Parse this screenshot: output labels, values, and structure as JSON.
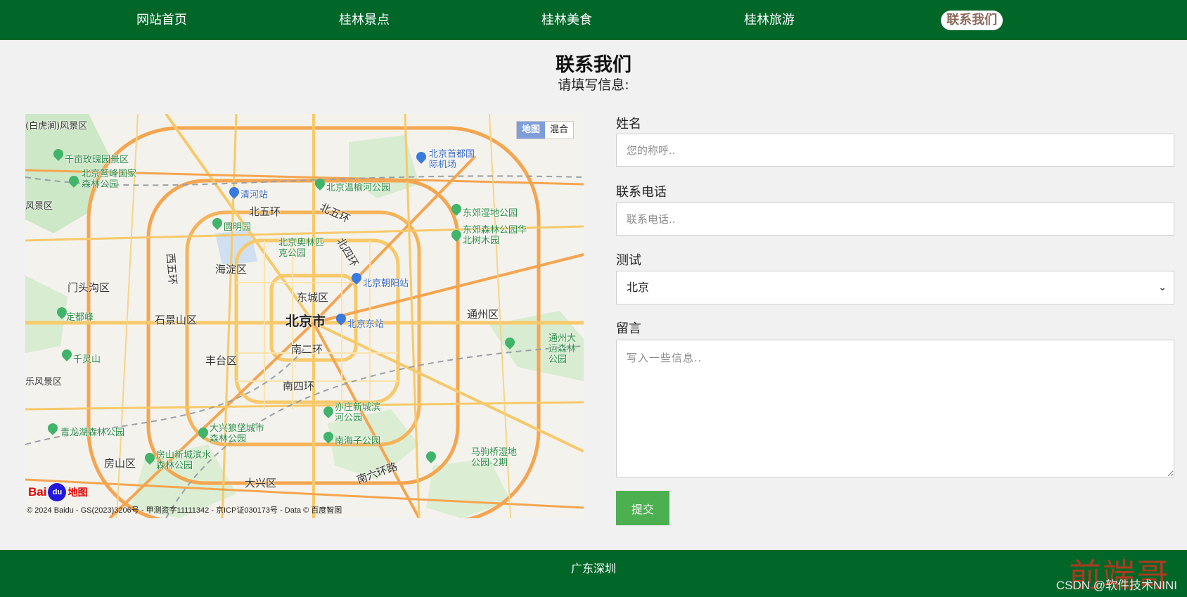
{
  "nav": {
    "items": [
      {
        "label": "网站首页",
        "active": false
      },
      {
        "label": "桂林景点",
        "active": false
      },
      {
        "label": "桂林美食",
        "active": false
      },
      {
        "label": "桂林旅游",
        "active": false
      },
      {
        "label": "联系我们",
        "active": true
      }
    ]
  },
  "header": {
    "title": "联系我们",
    "subtitle": "请填写信息:"
  },
  "map": {
    "switch": {
      "map": "地图",
      "hybrid": "混合",
      "selected": "地图"
    },
    "logo": {
      "left": "Bai",
      "paw": "du",
      "right": "地图"
    },
    "copyright": "© 2024 Baidu - GS(2023)3206号 - 甲测资字11111342 - 京ICP证030173号 - Data © 百度智图",
    "labels": {
      "beijing": "北京市",
      "haidian": "海淀区",
      "dongcheng": "东城区",
      "shijingshan": "石景山区",
      "fengtai": "丰台区",
      "mentougou": "门头沟区",
      "tongzhou": "通州区",
      "fangshan": "房山区",
      "daxing": "大兴区",
      "ring2": "南二环",
      "ring4s": "南四环",
      "ring5n": "北五环",
      "ring5n2": "北五环",
      "ring4n": "北四环",
      "ring5w": "西五环",
      "ring6s": "南六环路",
      "yuanmingyuan": "圆明园",
      "olympic": "北京奥林匹克公园",
      "qinghe": "清河站",
      "chaoyang_st": "北京朝阳站",
      "east_st": "北京东站",
      "airport": "北京首都国际机场",
      "dingdu": "定都峰",
      "qianmian": "千亩玫瑰园景区",
      "jiufeng": "北京鹫峰国家森林公园",
      "wenyu": "北京温榆河公园",
      "dongjiao": "东郊湿地公园",
      "dongjiao2": "东郊森林公园华北树木园",
      "yizhuang": "亦庄新城滨河公园",
      "nanhaizi": "南海子公园",
      "qinglong": "青龙湖森林公园",
      "daxing_park": "大兴狼垡城市森林公园",
      "fangshan_park": "房山新城滨水森林公园",
      "mafang": "马驹桥湿地公园-2期",
      "qianlingshan": "千灵山",
      "tongzhou_park": "通州大运森林公园",
      "baihuashan": "(白虎涧)风景区",
      "fengjingqu": "风景区",
      "fengjingqu2": "乐风景区"
    }
  },
  "form": {
    "name_label": "姓名",
    "name_placeholder": "您的称呼..",
    "phone_label": "联系电话",
    "phone_placeholder": "联系电话..",
    "test_label": "测试",
    "test_selected": "北京",
    "message_label": "留言",
    "message_placeholder": "写入一些信息..",
    "submit_label": "提交"
  },
  "footer": {
    "text": "广东深圳"
  },
  "watermark": {
    "red": "前端哥",
    "csdn": "CSDN @软件技术NINI"
  }
}
